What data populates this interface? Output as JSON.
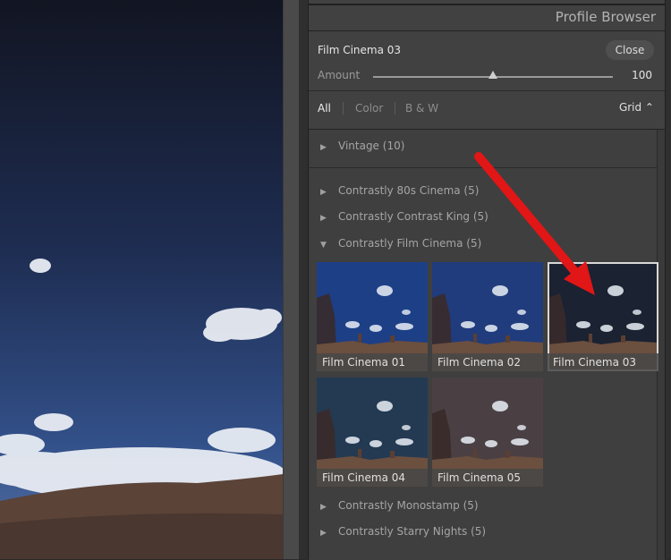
{
  "panel": {
    "title": "Profile Browser",
    "profile_name": "Film Cinema 03",
    "close_label": "Close",
    "amount_label": "Amount",
    "amount_value": "100",
    "amount_fraction": 0.5
  },
  "filters": {
    "all": "All",
    "color": "Color",
    "bw": "B & W",
    "view": "Grid ⌃"
  },
  "groups": {
    "vintage": "Vintage (10)",
    "eighties": "Contrastly 80s Cinema (5)",
    "contrast_king": "Contrastly Contrast King (5)",
    "film_cinema": "Contrastly Film Cinema (5)",
    "monostamp": "Contrastly Monostamp (5)",
    "starry": "Contrastly Starry Nights (5)"
  },
  "thumbnails": [
    {
      "label": "Film Cinema 01",
      "sky": "#1d3f86"
    },
    {
      "label": "Film Cinema 02",
      "sky": "#203c7c"
    },
    {
      "label": "Film Cinema 03",
      "sky": "#1b2232",
      "selected": true
    },
    {
      "label": "Film Cinema 04",
      "sky": "#233a52"
    },
    {
      "label": "Film Cinema 05",
      "sky": "#4a4044"
    }
  ],
  "icons": {
    "collapsed": "▶",
    "expanded": "▼"
  },
  "colors": {
    "annotation_arrow": "#e11616",
    "panel_bg": "#414141"
  }
}
